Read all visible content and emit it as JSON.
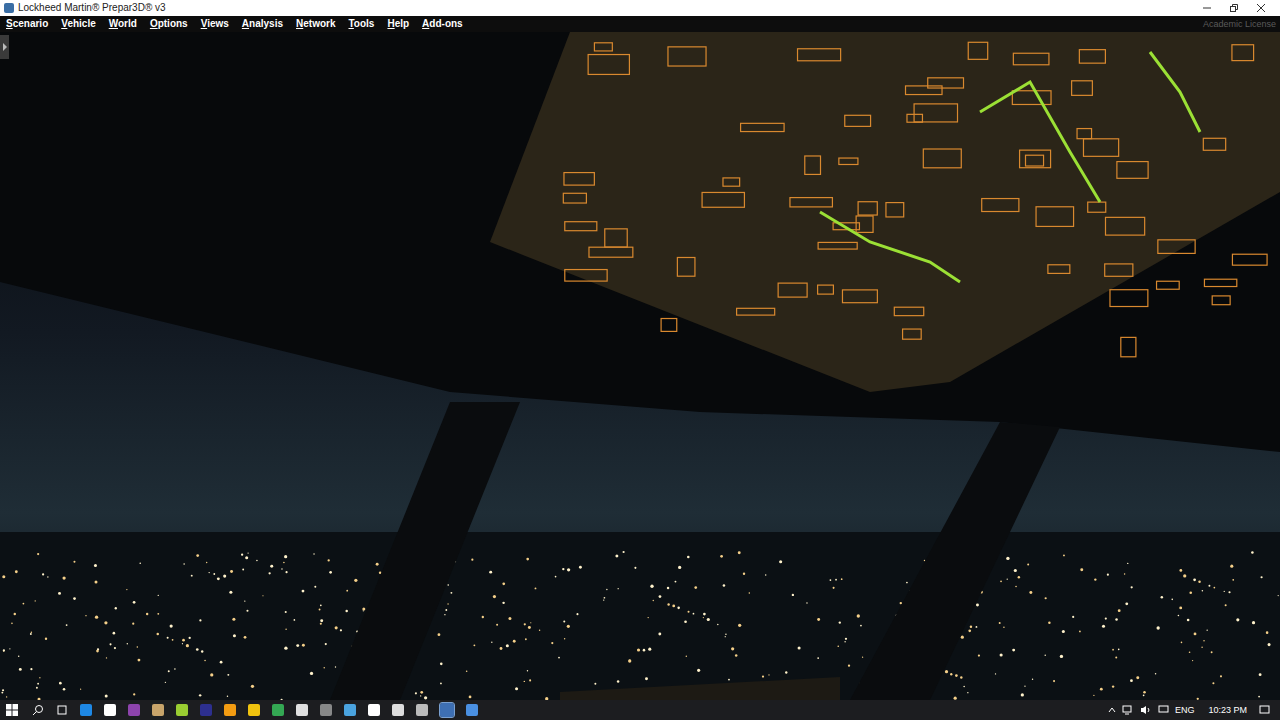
{
  "window": {
    "title": "Lockheed Martin® Prepar3D® v3",
    "watermark": "Academic License"
  },
  "menu": [
    {
      "label": "Scenario"
    },
    {
      "label": "Vehicle"
    },
    {
      "label": "World"
    },
    {
      "label": "Options"
    },
    {
      "label": "Views"
    },
    {
      "label": "Analysis"
    },
    {
      "label": "Network"
    },
    {
      "label": "Tools"
    },
    {
      "label": "Help"
    },
    {
      "label": "Add-ons"
    }
  ],
  "taskbar": {
    "language": "ENG",
    "time": "10:23 PM"
  }
}
